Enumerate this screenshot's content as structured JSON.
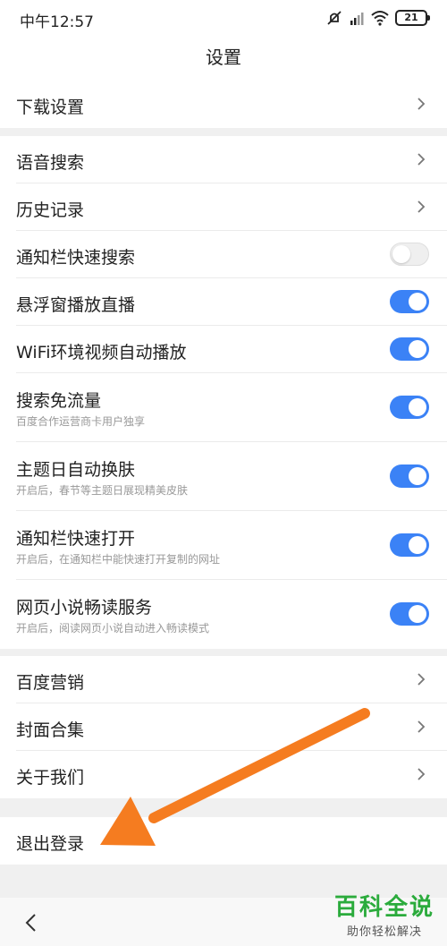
{
  "status": {
    "time": "中午12:57",
    "battery": "21"
  },
  "header": {
    "title": "设置"
  },
  "section1": {
    "download_settings": "下载设置"
  },
  "section2": {
    "voice_search": "语音搜索",
    "history": "历史记录",
    "notif_quick_search": "通知栏快速搜索",
    "float_window_live": "悬浮窗播放直播",
    "wifi_autoplay": "WiFi环境视频自动播放",
    "search_free_data": "搜索免流量",
    "search_free_data_sub": "百度合作运营商卡用户独享",
    "theme_day_skin": "主题日自动换肤",
    "theme_day_skin_sub": "开启后，春节等主题日展现精美皮肤",
    "notif_quick_open": "通知栏快速打开",
    "notif_quick_open_sub": "开启后，在通知栏中能快速打开复制的网址",
    "web_novel": "网页小说畅读服务",
    "web_novel_sub": "开启后，阅读网页小说自动进入畅读模式"
  },
  "section3": {
    "baidu_marketing": "百度营销",
    "cover_collection": "封面合集",
    "about_us": "关于我们"
  },
  "section4": {
    "logout": "退出登录"
  },
  "toggles": {
    "notif_quick_search": false,
    "float_window_live": true,
    "wifi_autoplay": true,
    "search_free_data": true,
    "theme_day_skin": true,
    "notif_quick_open": true,
    "web_novel": true
  },
  "watermark": {
    "big": "百科全说",
    "small": "助你轻松解决"
  },
  "colors": {
    "toggle_on": "#3b82f6",
    "arrow": "#f57c20",
    "watermark": "#2bab3c"
  }
}
